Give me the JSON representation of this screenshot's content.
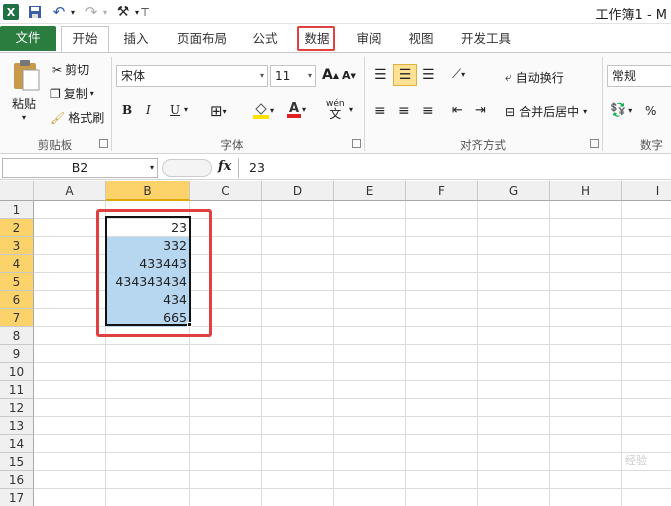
{
  "window": {
    "title": "工作簿1 - M"
  },
  "quick_access": {
    "app_icon": "X"
  },
  "tabs": [
    {
      "label": "文件"
    },
    {
      "label": "开始"
    },
    {
      "label": "插入"
    },
    {
      "label": "页面布局"
    },
    {
      "label": "公式"
    },
    {
      "label": "数据"
    },
    {
      "label": "审阅"
    },
    {
      "label": "视图"
    },
    {
      "label": "开发工具"
    }
  ],
  "ribbon": {
    "clipboard": {
      "paste": "粘贴",
      "cut": "剪切",
      "copy": "复制",
      "format_painter": "格式刷",
      "group": "剪贴板"
    },
    "font": {
      "family": "宋体",
      "size": "11",
      "bold": "B",
      "italic": "I",
      "underline": "U",
      "group": "字体",
      "grow": "A",
      "shrink": "A",
      "pinyin": "wén"
    },
    "alignment": {
      "wrap": "自动换行",
      "merge": "合并后居中",
      "group": "对齐方式"
    },
    "number": {
      "format": "常规",
      "percent": "%",
      "group": "数字"
    }
  },
  "formula_bar": {
    "name_box": "B2",
    "fx": "fx",
    "value": "23"
  },
  "sheet": {
    "columns": [
      "A",
      "B",
      "C",
      "D",
      "E",
      "F",
      "G",
      "H",
      "I"
    ],
    "rows": [
      "1",
      "2",
      "3",
      "4",
      "5",
      "6",
      "7",
      "8",
      "9",
      "10",
      "11",
      "12",
      "13",
      "14",
      "15",
      "16",
      "17"
    ],
    "selected_column": "B",
    "cells": [
      "23",
      "332",
      "433443",
      "434343434",
      "434",
      "665"
    ]
  },
  "watermark": "经验"
}
